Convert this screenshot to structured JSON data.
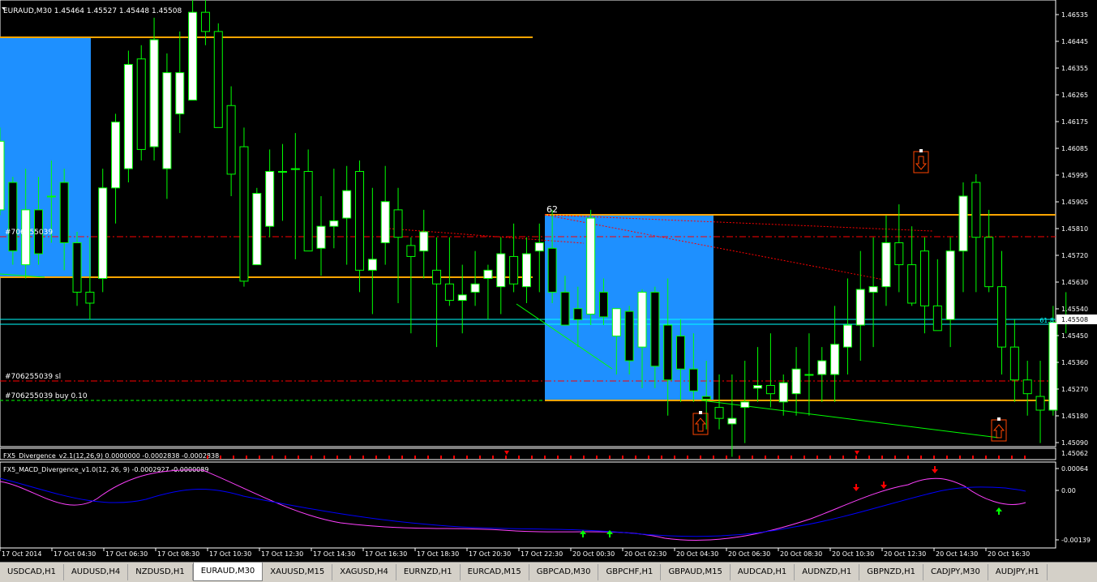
{
  "symbol_header": "EURAUD,M30  1.45464 1.45527 1.45448 1.45508",
  "colors": {
    "background": "#000000",
    "candle_bull": "#ffffff",
    "candle_bear": "#000000",
    "wick": "#00ff00",
    "zone": "#1e90ff",
    "level_line": "#ffa500",
    "bid_line": "#00ffff",
    "sl_line": "#ff0000",
    "order_line": "#00ff00",
    "macd_line": "#ff40ff",
    "signal_line": "#0000ff",
    "arrow_up": "#00ff00",
    "arrow_down": "#ff0000"
  },
  "price_axis": {
    "labels": [
      "1.46535",
      "1.46445",
      "1.46355",
      "1.46265",
      "1.46175",
      "1.46085",
      "1.45995",
      "1.45905",
      "1.45810",
      "1.45720",
      "1.45630",
      "1.45540",
      "1.45450",
      "1.45360",
      "1.45270",
      "1.45180",
      "1.45090"
    ],
    "current_price": "1.45508",
    "fib_label": "61.8",
    "bottom_label": "1.45062",
    "min": 1.4504,
    "max": 1.4665
  },
  "labels": {
    "fib_level": "62",
    "order_line": "#706255039",
    "sl_line": "#706255039 sl",
    "buy_line": "#706255039 buy 0.10"
  },
  "indicator1": {
    "title": "FX5_Divergence_v2.1(12,26,9) 0.0000000 -0.0002838 -0.0002838"
  },
  "indicator2": {
    "title": "FX5_MACD_Divergence_v1.0(12, 26, 9) -0.0002927 -0.0000089",
    "axis_labels": [
      "0.00064",
      "0.00",
      "-0.00139"
    ]
  },
  "time_axis": [
    "17 Oct 2014",
    "17 Oct 04:30",
    "17 Oct 06:30",
    "17 Oct 08:30",
    "17 Oct 10:30",
    "17 Oct 12:30",
    "17 Oct 14:30",
    "17 Oct 16:30",
    "17 Oct 18:30",
    "17 Oct 20:30",
    "17 Oct 22:30",
    "20 Oct 00:30",
    "20 Oct 02:30",
    "20 Oct 04:30",
    "20 Oct 06:30",
    "20 Oct 08:30",
    "20 Oct 10:30",
    "20 Oct 12:30",
    "20 Oct 14:30",
    "20 Oct 16:30"
  ],
  "tabs": [
    "USDCAD,H1",
    "AUDUSD,H4",
    "NZDUSD,H1",
    "EURAUD,M30",
    "XAUUSD,M15",
    "XAGUSD,H4",
    "EURNZD,H1",
    "EURCAD,M15",
    "GBPCAD,M30",
    "GBPCHF,H1",
    "GBPAUD,M15",
    "AUDCAD,H1",
    "AUDNZD,H1",
    "GBPNZD,H1",
    "CADJPY,M30",
    "AUDJPY,H1"
  ],
  "active_tab": 3,
  "chart_data": {
    "type": "candlestick",
    "ylim": [
      1.4504,
      1.4665
    ],
    "candles": [
      [
        1.459,
        1.462,
        1.4588,
        1.4615
      ],
      [
        1.46,
        1.4602,
        1.457,
        1.4575
      ],
      [
        1.457,
        1.4605,
        1.4565,
        1.459
      ],
      [
        1.459,
        1.4602,
        1.457,
        1.4574
      ],
      [
        1.4595,
        1.4608,
        1.4578,
        1.4595
      ],
      [
        1.46,
        1.4605,
        1.4568,
        1.4578
      ],
      [
        1.4578,
        1.4582,
        1.4555,
        1.456
      ],
      [
        1.456,
        1.458,
        1.455,
        1.4556
      ],
      [
        1.4565,
        1.4605,
        1.456,
        1.4598
      ],
      [
        1.4598,
        1.4625,
        1.4585,
        1.4622
      ],
      [
        1.4605,
        1.4648,
        1.46,
        1.4643
      ],
      [
        1.4645,
        1.465,
        1.4608,
        1.4612
      ],
      [
        1.4613,
        1.466,
        1.4608,
        1.4652
      ],
      [
        1.4605,
        1.4647,
        1.4594,
        1.464
      ],
      [
        1.4625,
        1.4655,
        1.4618,
        1.464
      ],
      [
        1.463,
        1.467,
        1.463,
        1.4662
      ],
      [
        1.4662,
        1.467,
        1.465,
        1.4655
      ],
      [
        1.4655,
        1.4658,
        1.462,
        1.462
      ],
      [
        1.4628,
        1.4635,
        1.4595,
        1.4603
      ],
      [
        1.4613,
        1.462,
        1.4562,
        1.4564
      ],
      [
        1.457,
        1.4598,
        1.457,
        1.4596
      ],
      [
        1.4584,
        1.4612,
        1.458,
        1.4604
      ],
      [
        1.4604,
        1.4614,
        1.4586,
        1.4604
      ],
      [
        1.4605,
        1.4618,
        1.4572,
        1.4605
      ],
      [
        1.4604,
        1.4612,
        1.4575,
        1.4575
      ],
      [
        1.4576,
        1.4595,
        1.4566,
        1.4584
      ],
      [
        1.4584,
        1.4605,
        1.4576,
        1.4586
      ],
      [
        1.4587,
        1.4606,
        1.457,
        1.4597
      ],
      [
        1.4604,
        1.4608,
        1.456,
        1.4568
      ],
      [
        1.4568,
        1.4598,
        1.4552,
        1.4572
      ],
      [
        1.4578,
        1.4606,
        1.457,
        1.4593
      ],
      [
        1.459,
        1.4598,
        1.4556,
        1.458
      ],
      [
        1.4577,
        1.458,
        1.4545,
        1.4573
      ],
      [
        1.4575,
        1.459,
        1.4565,
        1.4582
      ],
      [
        1.4568,
        1.458,
        1.454,
        1.4563
      ],
      [
        1.4563,
        1.458,
        1.4555,
        1.4557
      ],
      [
        1.4557,
        1.457,
        1.4545,
        1.4559
      ],
      [
        1.456,
        1.4575,
        1.4555,
        1.4563
      ],
      [
        1.4565,
        1.457,
        1.455,
        1.4568
      ],
      [
        1.4562,
        1.458,
        1.4552,
        1.4574
      ],
      [
        1.4573,
        1.4585,
        1.456,
        1.4563
      ],
      [
        1.4562,
        1.458,
        1.4556,
        1.4574
      ],
      [
        1.4575,
        1.4585,
        1.456,
        1.4578
      ],
      [
        1.4576,
        1.459,
        1.4556,
        1.456
      ],
      [
        1.456,
        1.4566,
        1.4552,
        1.4548
      ],
      [
        1.4554,
        1.4562,
        1.454,
        1.455
      ],
      [
        1.4552,
        1.459,
        1.4548,
        1.4587
      ],
      [
        1.456,
        1.4565,
        1.4548,
        1.4551
      ],
      [
        1.4544,
        1.4554,
        1.453,
        1.4554
      ],
      [
        1.4553,
        1.4555,
        1.453,
        1.4535
      ],
      [
        1.454,
        1.4561,
        1.4525,
        1.456
      ],
      [
        1.456,
        1.4562,
        1.4525,
        1.4533
      ],
      [
        1.4548,
        1.4565,
        1.4515,
        1.4528
      ],
      [
        1.4544,
        1.455,
        1.452,
        1.4532
      ],
      [
        1.4532,
        1.4545,
        1.452,
        1.4524
      ],
      [
        1.4522,
        1.4535,
        1.451,
        1.4521
      ],
      [
        1.4518,
        1.453,
        1.451,
        1.4514
      ],
      [
        1.4512,
        1.453,
        1.45,
        1.4514
      ],
      [
        1.4518,
        1.4535,
        1.4505,
        1.452
      ],
      [
        1.4525,
        1.454,
        1.452,
        1.4526
      ],
      [
        1.4526,
        1.4545,
        1.4518,
        1.4523
      ],
      [
        1.452,
        1.453,
        1.4515,
        1.4527
      ],
      [
        1.4523,
        1.454,
        1.4515,
        1.4532
      ],
      [
        1.453,
        1.4545,
        1.4515,
        1.453
      ],
      [
        1.453,
        1.454,
        1.452,
        1.4535
      ],
      [
        1.453,
        1.4555,
        1.452,
        1.4541
      ],
      [
        1.454,
        1.4565,
        1.453,
        1.4548
      ],
      [
        1.4548,
        1.4575,
        1.4535,
        1.4561
      ],
      [
        1.456,
        1.458,
        1.454,
        1.4562
      ],
      [
        1.4562,
        1.4588,
        1.4555,
        1.4578
      ],
      [
        1.4578,
        1.4592,
        1.456,
        1.457
      ],
      [
        1.457,
        1.4584,
        1.4555,
        1.4556
      ],
      [
        1.4575,
        1.458,
        1.4545,
        1.4555
      ],
      [
        1.4555,
        1.4572,
        1.4546,
        1.4546
      ],
      [
        1.455,
        1.458,
        1.454,
        1.4575
      ],
      [
        1.4575,
        1.46,
        1.456,
        1.4595
      ],
      [
        1.46,
        1.4603,
        1.456,
        1.458
      ],
      [
        1.458,
        1.459,
        1.456,
        1.4562
      ],
      [
        1.4562,
        1.4575,
        1.453,
        1.454
      ],
      [
        1.454,
        1.455,
        1.452,
        1.4528
      ],
      [
        1.4528,
        1.4535,
        1.4515,
        1.4523
      ],
      [
        1.4522,
        1.4535,
        1.4505,
        1.4517
      ],
      [
        1.4517,
        1.4555,
        1.4515,
        1.4549
      ],
      [
        1.4549,
        1.456,
        1.4545,
        1.4551
      ]
    ]
  }
}
